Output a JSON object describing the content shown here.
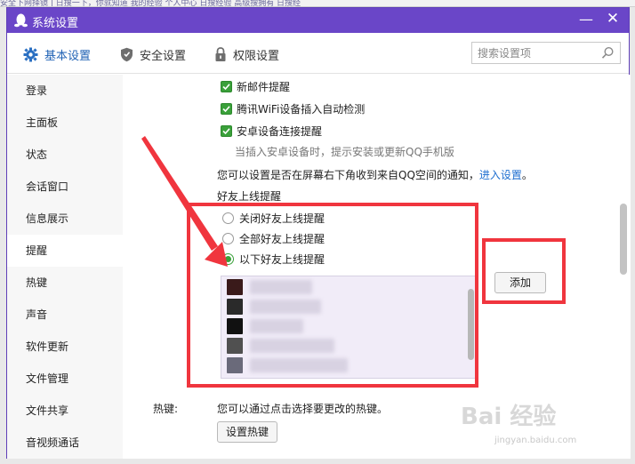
{
  "window": {
    "title": "系统设置",
    "minimize": "—",
    "close": "✕"
  },
  "tabs": [
    {
      "label": "基本设置",
      "icon": "gear-icon",
      "active": true
    },
    {
      "label": "安全设置",
      "icon": "shield-icon",
      "active": false
    },
    {
      "label": "权限设置",
      "icon": "lock-icon",
      "active": false
    }
  ],
  "search": {
    "placeholder": "搜索设置项"
  },
  "sidebar": {
    "items": [
      {
        "label": "登录"
      },
      {
        "label": "主面板"
      },
      {
        "label": "状态"
      },
      {
        "label": "会话窗口"
      },
      {
        "label": "信息展示"
      },
      {
        "label": "提醒",
        "active": true
      },
      {
        "label": "热键"
      },
      {
        "label": "声音"
      },
      {
        "label": "软件更新"
      },
      {
        "label": "文件管理"
      },
      {
        "label": "文件共享"
      },
      {
        "label": "音视频通话"
      }
    ]
  },
  "content": {
    "checkboxes": [
      {
        "label": "新邮件提醒",
        "checked": true
      },
      {
        "label": "腾讯WiFi设备插入自动检测",
        "checked": true
      },
      {
        "label": "安卓设备连接提醒",
        "checked": true
      }
    ],
    "android_hint": "当插入安卓设备时，提示安装或更新QQ手机版",
    "qzone_notice": "您可以设置是否在屏幕右下角收到来自QQ空间的通知，",
    "qzone_link": "进入设置",
    "qzone_period": "。",
    "friend_online_title": "好友上线提醒",
    "radios": [
      {
        "label": "关闭好友上线提醒",
        "selected": false
      },
      {
        "label": "全部好友上线提醒",
        "selected": false
      },
      {
        "label": "以下好友上线提醒",
        "selected": true
      }
    ],
    "add_button": "添加",
    "hotkey_label": "热键:",
    "hotkey_desc": "您可以通过点击选择要更改的热键。",
    "hotkey_button": "设置热键"
  },
  "background": {
    "strip_text": "安全下网择镜    | 日搜一下，你就知道    我的经验  个人中心  日搜经验    高级搜拥有  日搜经"
  },
  "watermark": {
    "text": "Bai 经验",
    "url": "jingyan.baidu.com"
  },
  "colors": {
    "titlebar": "#6a46c8",
    "accent": "#2163b5",
    "check": "#3aa03a",
    "annotation": "#f0353e"
  }
}
